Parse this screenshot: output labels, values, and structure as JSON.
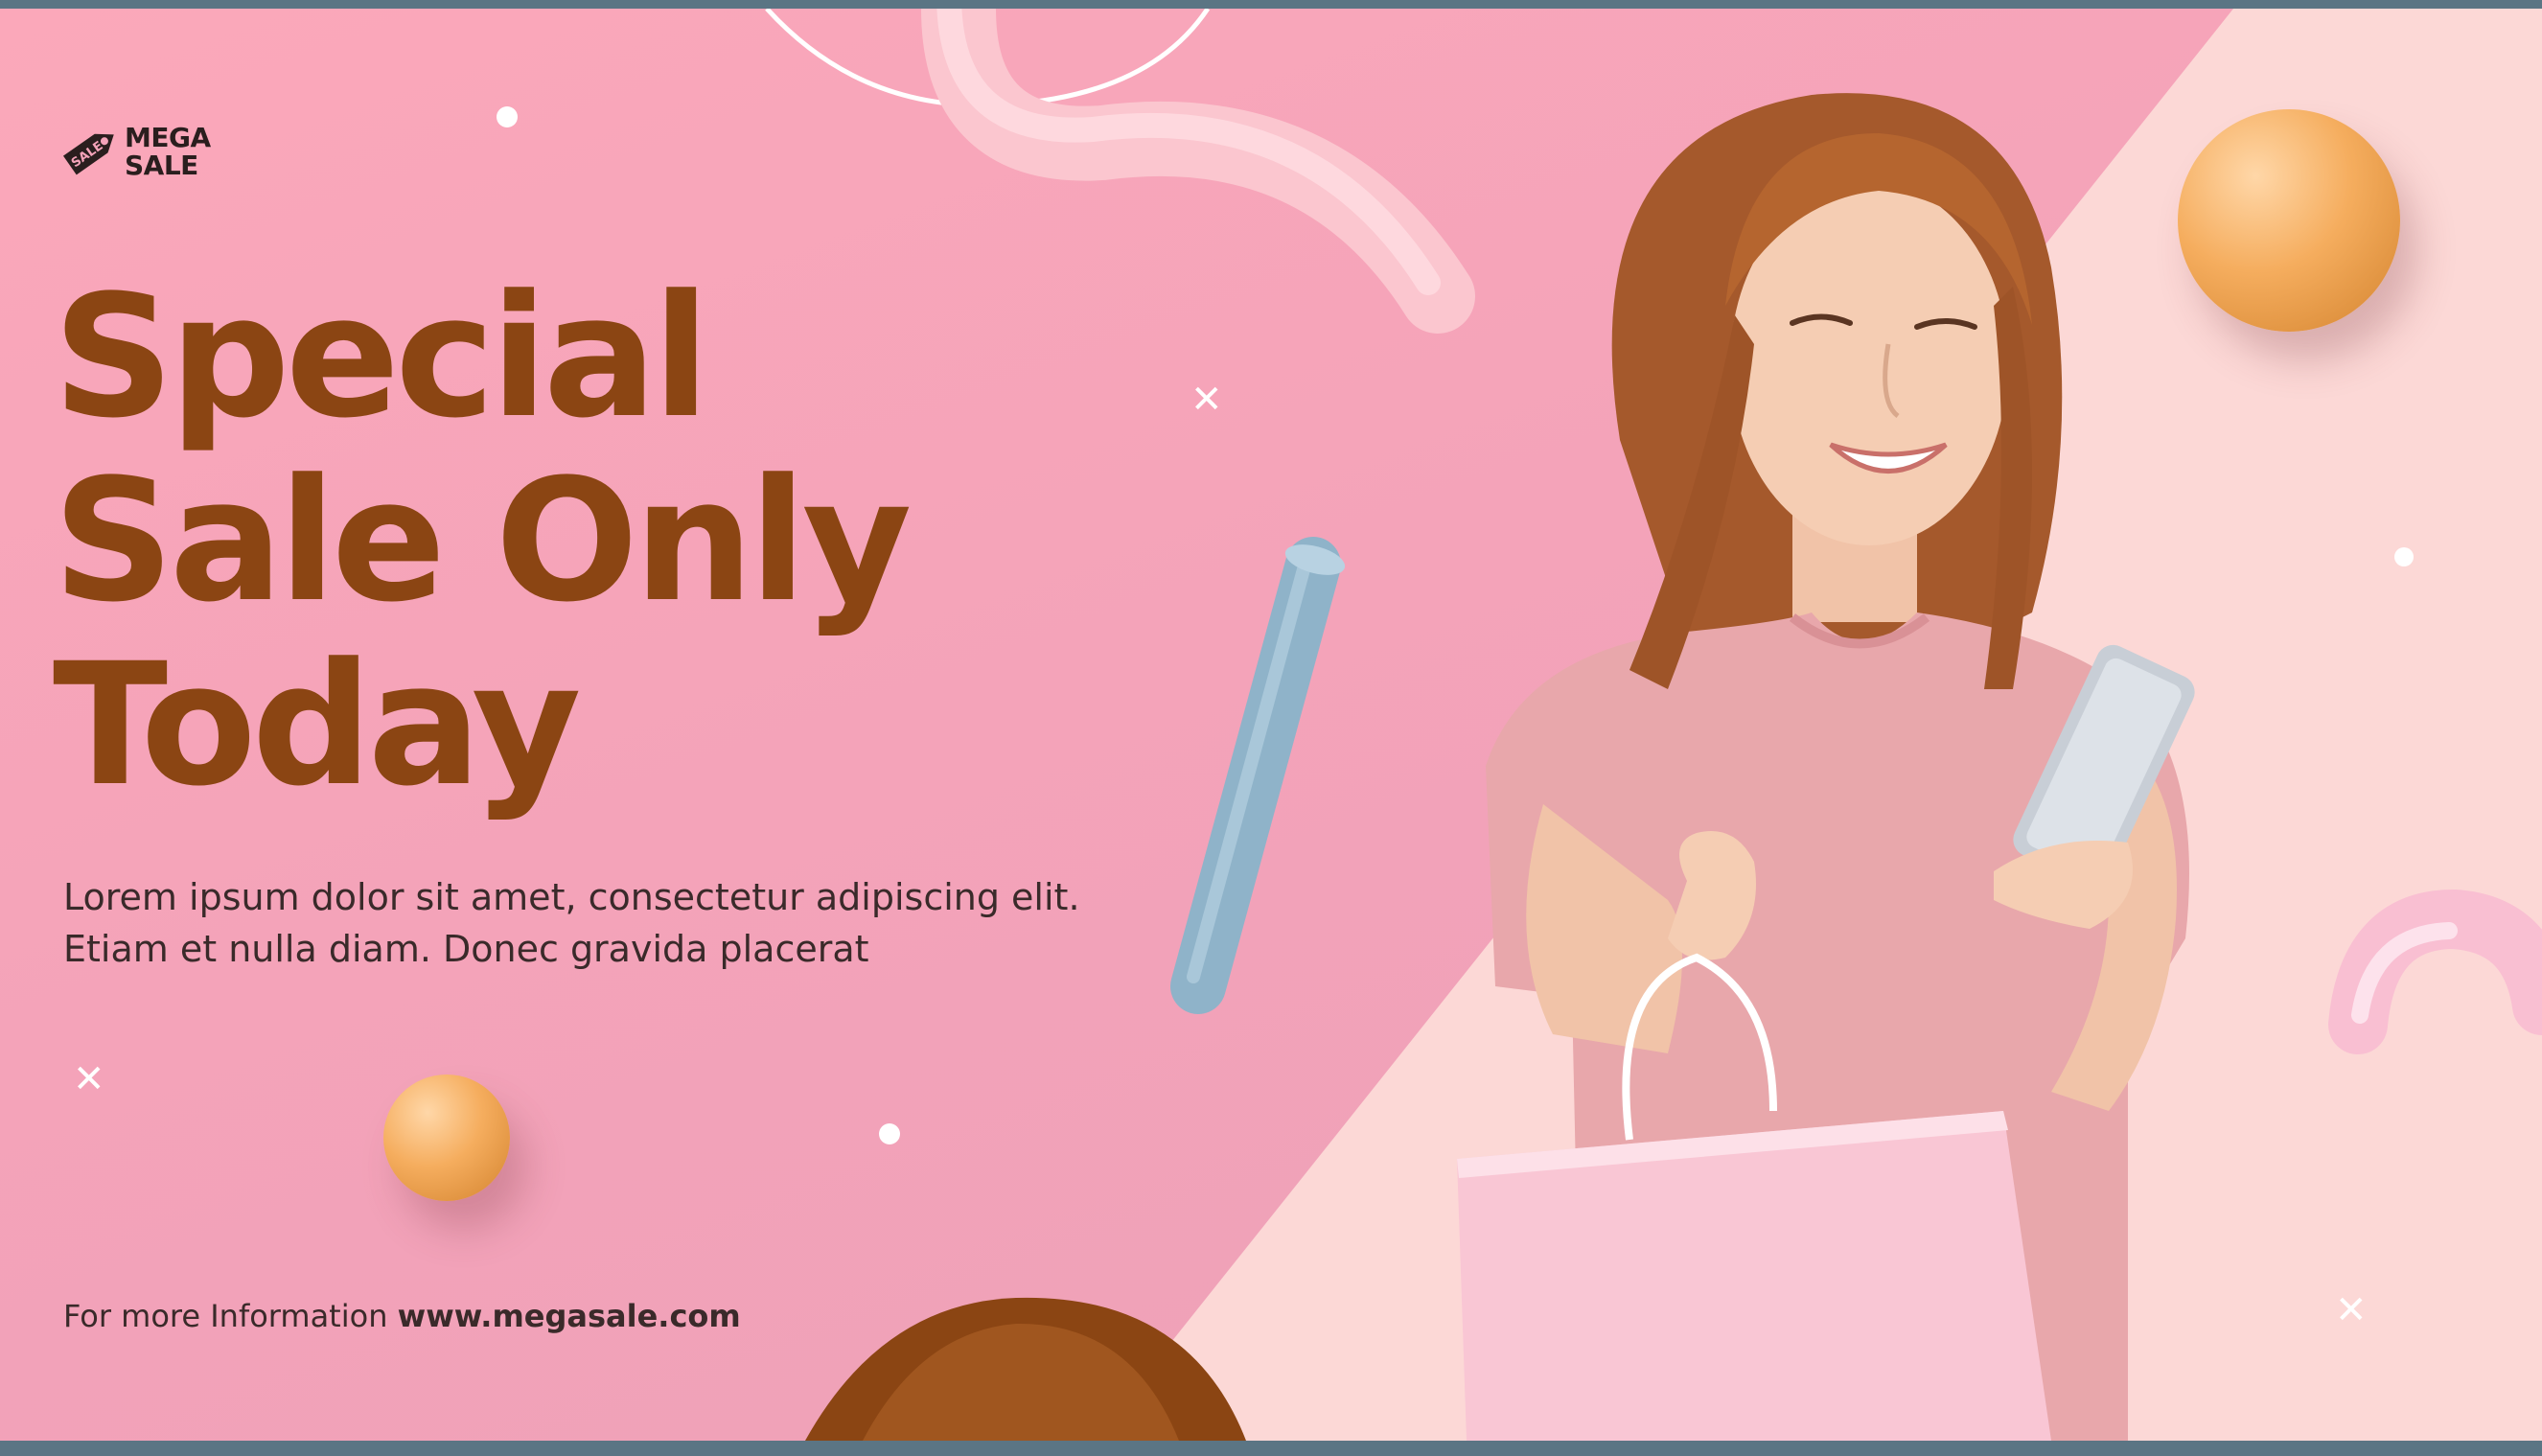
{
  "brand": {
    "logo_icon": "sale-tag-icon",
    "logo_tag_text": "SALE",
    "logo_line1": "MEGA",
    "logo_line2": "SALE"
  },
  "headline": {
    "line1": "Special",
    "line2": "Sale Only",
    "line3": "Today"
  },
  "body": {
    "text": "Lorem ipsum dolor sit amet, consectetur adipiscing elit. Etiam et nulla diam. Donec gravida placerat"
  },
  "footer": {
    "info_label": "For more Information",
    "url": "www.megasale.com"
  },
  "colors": {
    "headline": "#8b4513",
    "background_pink": "#f4a3b9",
    "background_light": "#fcd6d6",
    "accent_orange": "#f5ad5e",
    "accent_blue": "#8fb3c9"
  }
}
